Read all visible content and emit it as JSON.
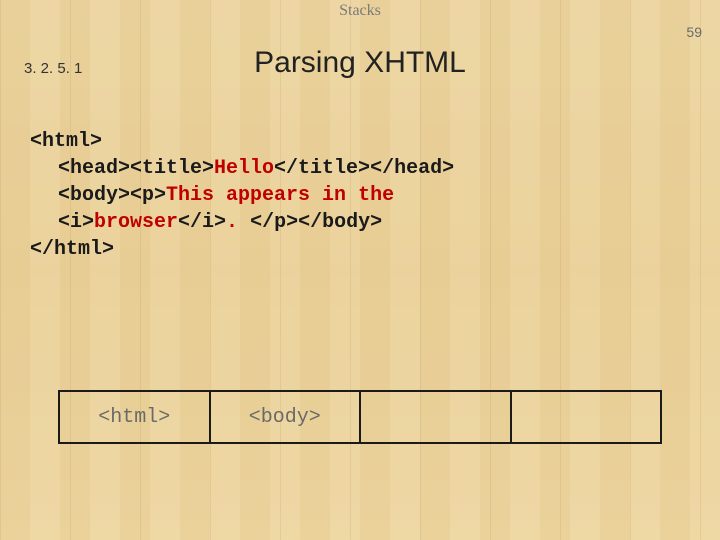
{
  "header": {
    "topic": "Stacks",
    "page_number": "59",
    "section_number": "3. 2. 5. 1",
    "title": "Parsing XHTML"
  },
  "code": {
    "l1": "<html>",
    "l2a": "<head><title>",
    "l2b": "Hello",
    "l2c": "</title></head>",
    "l3a": "<body><p>",
    "l3b": "This appears in the",
    "l4a": "<i>",
    "l4b": "browser",
    "l4c": "</i>",
    "l4d": ". ",
    "l4e": "</p></body>",
    "l5": "</html>"
  },
  "stack": {
    "cells": [
      "<html>",
      "<body>",
      "",
      ""
    ]
  }
}
